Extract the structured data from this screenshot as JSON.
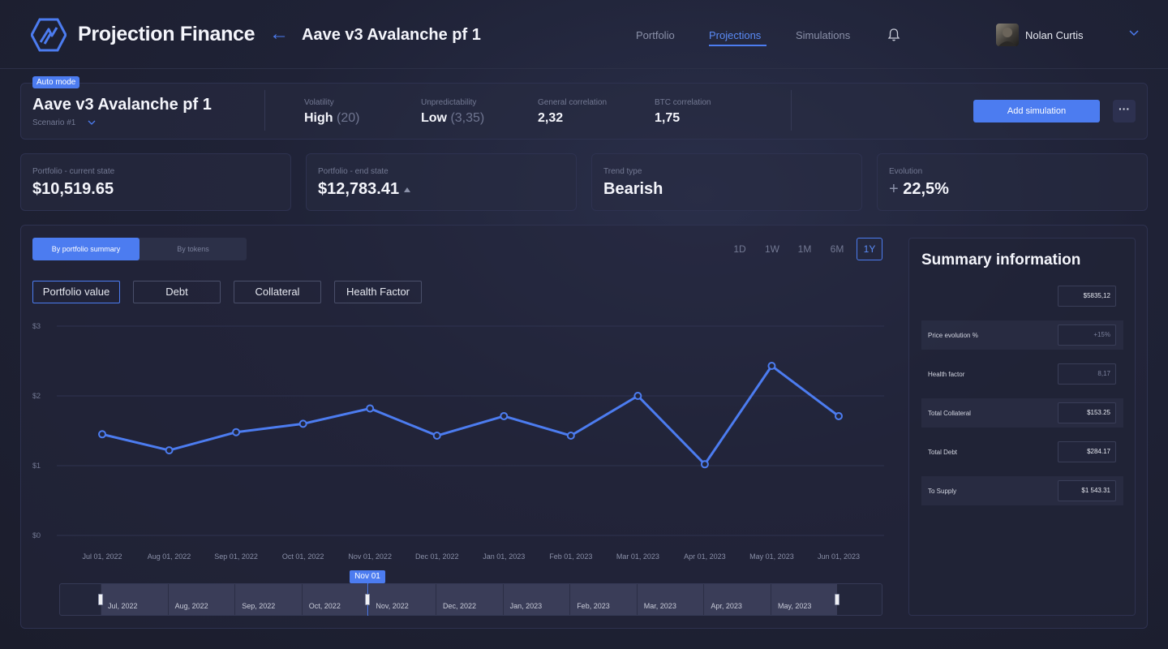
{
  "header": {
    "brand": "Projection Finance",
    "page_title": "Aave v3 Avalanche pf 1",
    "nav": [
      {
        "label": "Portfolio",
        "active": false
      },
      {
        "label": "Projections",
        "active": true
      },
      {
        "label": "Simulations",
        "active": false
      }
    ],
    "user_name": "Nolan Curtis",
    "accent": "#4c7cf0"
  },
  "scenario": {
    "badge": "Auto mode",
    "title": "Aave v3 Avalanche pf 1",
    "subtitle": "Scenario #1",
    "metrics": [
      {
        "label": "Volatility",
        "value": "High",
        "extra": "(20)"
      },
      {
        "label": "Unpredictability",
        "value": "Low",
        "extra": "(3,35)"
      },
      {
        "label": "General correlation",
        "value": "2,32",
        "extra": ""
      },
      {
        "label": "BTC correlation",
        "value": "1,75",
        "extra": ""
      }
    ],
    "add_button": "Add simulation",
    "more_button": "···"
  },
  "stats": [
    {
      "label": "Portfolio - current state",
      "value": "$10,519.65"
    },
    {
      "label": "Portfolio - end state",
      "value": "$12,783.41"
    },
    {
      "label": "Trend type",
      "value": "Bearish"
    },
    {
      "label": "Evolution",
      "prefix": "+",
      "value": "22,5%"
    }
  ],
  "view_toggle": {
    "on": "By portfolio summary",
    "off": "By tokens"
  },
  "ranges": [
    {
      "label": "1D",
      "active": false
    },
    {
      "label": "1W",
      "active": false
    },
    {
      "label": "1M",
      "active": false
    },
    {
      "label": "6M",
      "active": false
    },
    {
      "label": "1Y",
      "active": true
    }
  ],
  "filters": [
    {
      "label": "Portfolio value",
      "active": true
    },
    {
      "label": "Debt",
      "active": false
    },
    {
      "label": "Collateral",
      "active": false
    },
    {
      "label": "Health Factor",
      "active": false
    }
  ],
  "chart_data": {
    "type": "line",
    "x": [
      "Jul 01, 2022",
      "Aug 01, 2022",
      "Sep 01, 2022",
      "Oct 01, 2022",
      "Nov 01, 2022",
      "Dec 01, 2022",
      "Jan 01, 2023",
      "Feb 01, 2023",
      "Mar 01, 2023",
      "Apr 01, 2023",
      "May 01, 2023",
      "Jun 01, 2023"
    ],
    "series": [
      {
        "values": [
          1.45,
          1.22,
          1.48,
          1.6,
          1.82,
          1.43,
          1.71,
          1.43,
          2.0,
          1.02,
          2.43,
          1.71
        ],
        "color": "#4c7cf0"
      }
    ],
    "y_ticks": [
      "$0",
      "$1",
      "$2",
      "$3"
    ],
    "ylim": [
      0,
      3
    ],
    "grid": true
  },
  "timeline": {
    "months": [
      "Jul, 2022",
      "Aug, 2022",
      "Sep, 2022",
      "Oct, 2022",
      "Nov, 2022",
      "Dec, 2022",
      "Jan, 2023",
      "Feb, 2023",
      "Mar, 2023",
      "Apr, 2023",
      "May, 2023"
    ],
    "cursor_label": "Nov 01"
  },
  "summary": {
    "title": "Summary information",
    "rows": [
      {
        "label": "",
        "value": "$5835,12"
      },
      {
        "label": "Price evolution %",
        "value": "+15%"
      },
      {
        "label": "Health factor",
        "value": "8,17"
      },
      {
        "label": "Total Collateral",
        "value": "$153.25"
      },
      {
        "label": "Total Debt",
        "value": "$284.17"
      },
      {
        "label": "To Supply",
        "value": "$1 543.31"
      }
    ]
  }
}
